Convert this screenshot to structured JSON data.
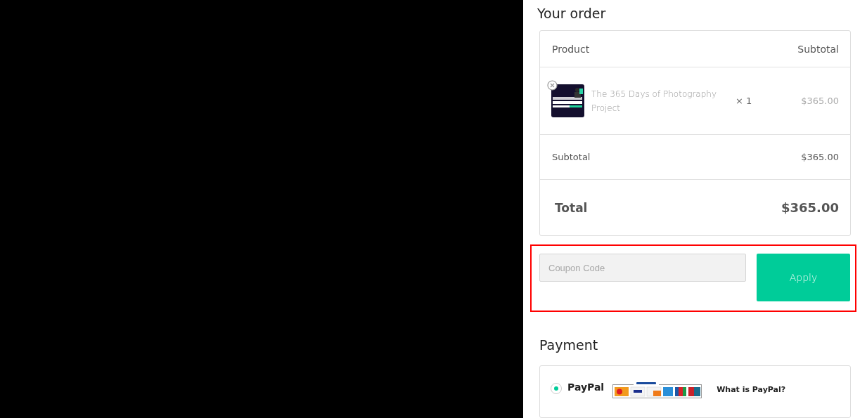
{
  "order": {
    "title": "Your order",
    "columns": [
      "Product",
      "Subtotal"
    ],
    "items": [
      {
        "kind": "picture",
        "name": "The 365 Days of Photography Project",
        "quantity": "× 1",
        "price": "$365.00"
      }
    ],
    "subtotal": {
      "label": "Subtotal",
      "value": "$365.00"
    },
    "total": {
      "label": "Total",
      "value": "$365.00"
    }
  },
  "coupon": {
    "placeholder": "Coupon Code",
    "button": "Apply",
    "highlighted": true
  },
  "payment": {
    "title": "Payment",
    "methods": [
      {
        "label": "PayPal",
        "selected": true,
        "link": "What is PayPal?"
      }
    ]
  }
}
